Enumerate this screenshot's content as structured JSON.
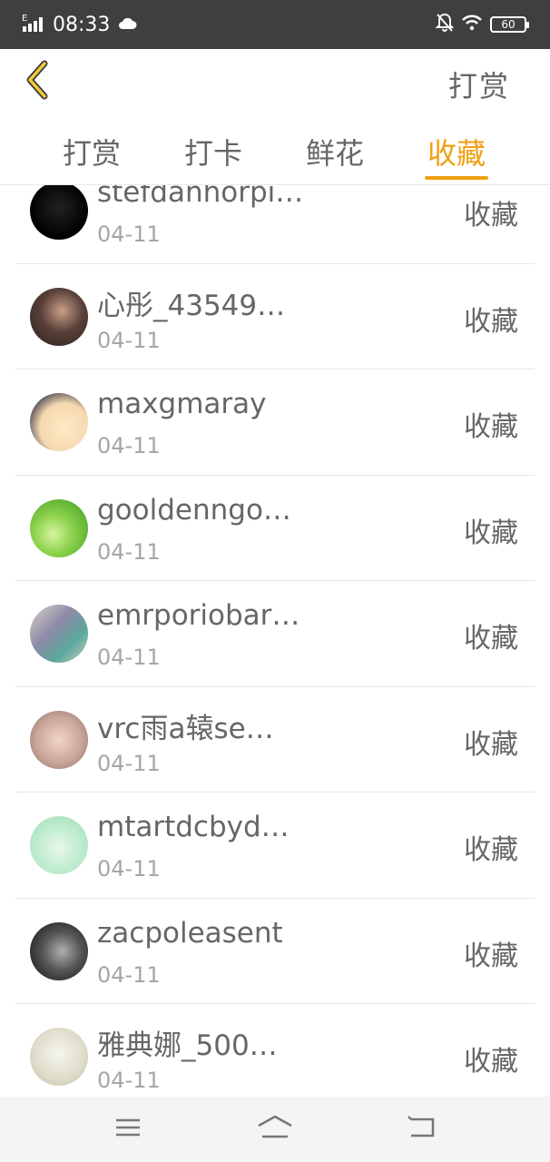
{
  "status_bar": {
    "time": "08:33",
    "battery": "60"
  },
  "header": {
    "title": "打赏"
  },
  "tabs": [
    {
      "label": "打赏",
      "active": false
    },
    {
      "label": "打卡",
      "active": false
    },
    {
      "label": "鲜花",
      "active": false
    },
    {
      "label": "收藏",
      "active": true
    }
  ],
  "colors": {
    "accent": "#f0a014",
    "text": "#666666",
    "subtext": "#a6a6a6",
    "status_bar": "#3f3f3f"
  },
  "list": {
    "items": [
      {
        "name": "stefdanhorpi…",
        "date": "04-11",
        "action": "收藏"
      },
      {
        "name": "心彤_43549…",
        "date": "04-11",
        "action": "收藏"
      },
      {
        "name": "maxgmaray",
        "date": "04-11",
        "action": "收藏"
      },
      {
        "name": "gooldenngo…",
        "date": "04-11",
        "action": "收藏"
      },
      {
        "name": "emrporiobar…",
        "date": "04-11",
        "action": "收藏"
      },
      {
        "name": "vrc雨a辕se…",
        "date": "04-11",
        "action": "收藏"
      },
      {
        "name": "mtartdcbyd…",
        "date": "04-11",
        "action": "收藏"
      },
      {
        "name": "zacpoleasent",
        "date": "04-11",
        "action": "收藏"
      },
      {
        "name": "雅典娜_500…",
        "date": "04-11",
        "action": "收藏"
      }
    ]
  },
  "icons": {
    "back": "chevron-left-icon",
    "menu": "menu-icon",
    "home": "home-icon",
    "return": "return-icon"
  }
}
